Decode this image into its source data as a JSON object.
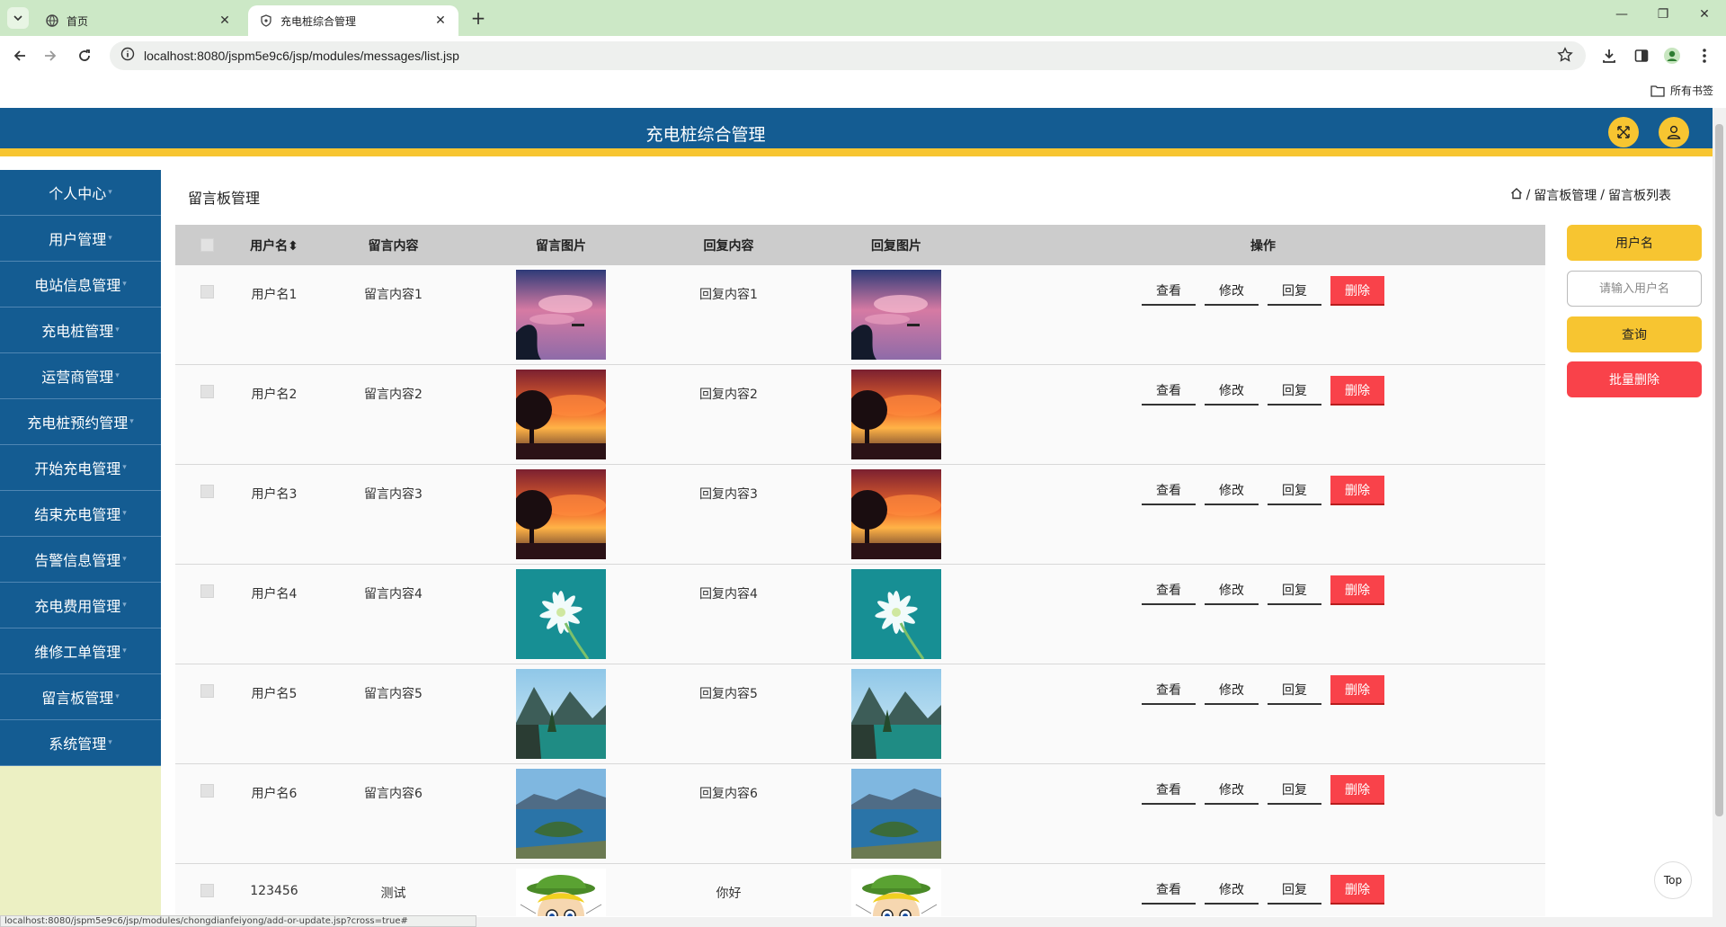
{
  "browser": {
    "tabs": [
      {
        "title": "首页",
        "active": false
      },
      {
        "title": "充电桩综合管理",
        "active": true
      }
    ],
    "url": "localhost:8080/jspm5e9c6/jsp/modules/messages/list.jsp",
    "bookmarks_label": "所有书签",
    "status_url": "localhost:8080/jspm5e9c6/jsp/modules/chongdianfeiyong/add-or-update.jsp?cross=true#"
  },
  "header": {
    "title": "充电桩综合管理"
  },
  "sidebar": {
    "items": [
      {
        "label": "个人中心"
      },
      {
        "label": "用户管理"
      },
      {
        "label": "电站信息管理"
      },
      {
        "label": "充电桩管理"
      },
      {
        "label": "运营商管理"
      },
      {
        "label": "充电桩预约管理"
      },
      {
        "label": "开始充电管理"
      },
      {
        "label": "结束充电管理"
      },
      {
        "label": "告警信息管理"
      },
      {
        "label": "充电费用管理"
      },
      {
        "label": "维修工单管理"
      },
      {
        "label": "留言板管理"
      },
      {
        "label": "系统管理"
      }
    ]
  },
  "page": {
    "title": "留言板管理",
    "breadcrumb": [
      "留言板管理",
      "留言板列表"
    ]
  },
  "table": {
    "columns": [
      "用户名",
      "留言内容",
      "留言图片",
      "回复内容",
      "回复图片",
      "操作"
    ],
    "sort_indicator": "⬍",
    "rows": [
      {
        "username": "用户名1",
        "content": "留言内容1",
        "image": "pink-sky-tree",
        "reply": "回复内容1",
        "reply_image": "pink-sky-tree"
      },
      {
        "username": "用户名2",
        "content": "留言内容2",
        "image": "sunset-tree",
        "reply": "回复内容2",
        "reply_image": "sunset-tree"
      },
      {
        "username": "用户名3",
        "content": "留言内容3",
        "image": "sunset-tree",
        "reply": "回复内容3",
        "reply_image": "sunset-tree"
      },
      {
        "username": "用户名4",
        "content": "留言内容4",
        "image": "white-flower",
        "reply": "回复内容4",
        "reply_image": "white-flower"
      },
      {
        "username": "用户名5",
        "content": "留言内容5",
        "image": "mountain-lake",
        "reply": "回复内容5",
        "reply_image": "mountain-lake"
      },
      {
        "username": "用户名6",
        "content": "留言内容6",
        "image": "island-lake",
        "reply": "回复内容6",
        "reply_image": "island-lake"
      },
      {
        "username": "123456",
        "content": "测试",
        "image": "cartoon-face",
        "reply": "你好",
        "reply_image": "cartoon-face"
      }
    ],
    "actions": {
      "view": "查看",
      "edit": "修改",
      "reply": "回复",
      "delete": "删除"
    }
  },
  "search_panel": {
    "field_label": "用户名",
    "placeholder": "请输入用户名",
    "search_label": "查询",
    "batch_delete_label": "批量删除"
  },
  "top_button": "Top",
  "colors": {
    "primary": "#145c92",
    "accent": "#f7c531",
    "danger": "#f9424a",
    "sidebar_bg": "#ecf0c3"
  }
}
